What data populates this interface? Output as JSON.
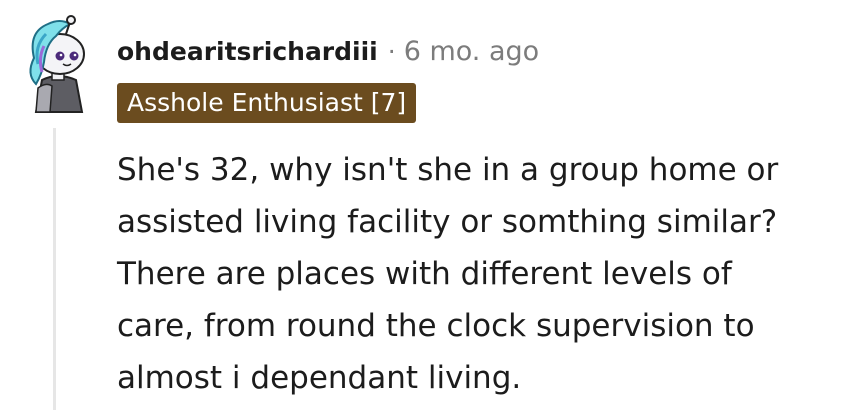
{
  "comment": {
    "author": "ohdearitsrichardiii",
    "separator": "·",
    "timestamp": "6 mo. ago",
    "flair": {
      "text": "Asshole Enthusiast [7]",
      "background": "#6b4c1f"
    },
    "body_lines": [
      "She's 32, why isn't she in a group home or",
      "assisted living facility or somthing similar?",
      "There are places with different levels of",
      "care, from round the clock supervision to",
      "almost i dependant living."
    ],
    "avatar_icon": "snoo-avatar-icon"
  }
}
